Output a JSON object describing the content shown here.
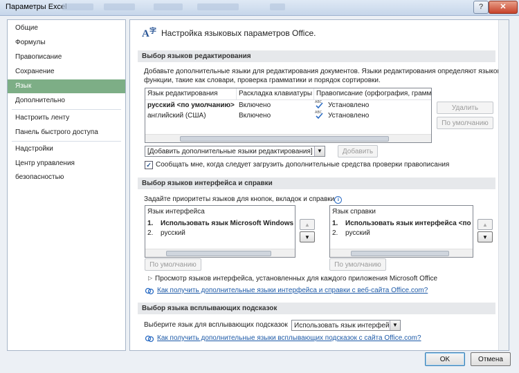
{
  "window": {
    "title": "Параметры Excel",
    "min_glyph": "–",
    "max_glyph": "□",
    "close_glyph": "✕"
  },
  "nav": {
    "items": [
      {
        "label": "Общие"
      },
      {
        "label": "Формулы"
      },
      {
        "label": "Правописание"
      },
      {
        "label": "Сохранение"
      },
      {
        "label": "Язык",
        "selected": true
      },
      {
        "label": "Дополнительно"
      },
      {
        "label": "Настроить ленту"
      },
      {
        "label": "Панель быстрого доступа"
      },
      {
        "label": "Надстройки"
      },
      {
        "label": "Центр управления безопасностью"
      }
    ]
  },
  "header": {
    "title": "Настройка языковых параметров Office.",
    "icon": "language-icon"
  },
  "editing": {
    "section_title": "Выбор языков редактирования",
    "description_line1": "Добавьте дополнительные языки для редактирования документов. Языки редактирования определяют языковые",
    "description_line2": "функции, такие как словари, проверка грамматики и порядок сортировки.",
    "columns": [
      "Язык редактирования",
      "Раскладка клавиатуры",
      "Правописание (орфография, граммат"
    ],
    "rows": [
      {
        "lang": "русский <по умолчанию>",
        "keyboard": "Включено",
        "proofing": "Установлено",
        "bold": true
      },
      {
        "lang": "английский (США)",
        "keyboard": "Включено",
        "proofing": "Установлено",
        "bold": false
      }
    ],
    "remove_button": "Удалить",
    "default_button": "По умолчанию",
    "add_combo_value": "[Добавить дополнительные языки редактирования]",
    "add_button": "Добавить",
    "notify_checkbox_label": "Сообщать мне, когда следует загрузить дополнительные средства проверки правописания",
    "notify_checked": true
  },
  "ui_lang": {
    "section_title": "Выбор языков интерфейса и справки",
    "description": "Задайте приоритеты языков для кнопок, вкладок и справки",
    "interface_header": "Язык интерфейса",
    "interface_items": [
      {
        "num": "1.",
        "label": "Использовать язык Microsoft Windows <по",
        "bold": true
      },
      {
        "num": "2.",
        "label": "русский",
        "bold": false
      }
    ],
    "help_header": "Язык справки",
    "help_items": [
      {
        "num": "1.",
        "label": "Использовать язык интерфейса <по ум",
        "bold": true
      },
      {
        "num": "2.",
        "label": "русский",
        "bold": false
      }
    ],
    "default_button": "По умолчанию",
    "help_default_button": "По умолчанию",
    "view_languages": "Просмотр языков интерфейса, установленных для каждого приложения Microsoft Office",
    "link_more": "Как получить дополнительные языки интерфейса и справки с веб-сайта Office.com?"
  },
  "tooltip": {
    "section_title": "Выбор языка всплывающих подсказок",
    "label": "Выберите язык для всплывающих подсказок",
    "combo_value": "Использовать язык интерфейса",
    "link": "Как получить дополнительные языки всплывающих подсказок с сайта Office.com?"
  },
  "footer": {
    "ok": "OK",
    "cancel": "Отмена"
  },
  "colors": {
    "nav_selected": "#7dae86",
    "link": "#1d5aa8"
  }
}
